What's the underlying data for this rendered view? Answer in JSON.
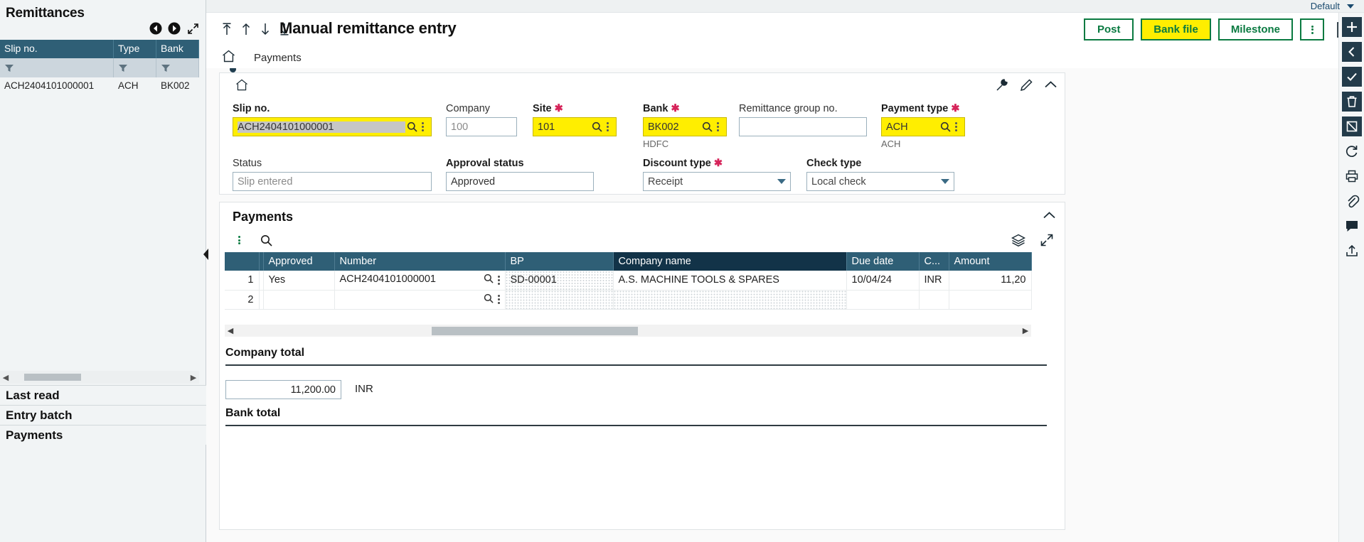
{
  "left_panel": {
    "title": "Remittances",
    "nav": {
      "prev": "prev-record",
      "next": "next-record",
      "expand": "expand"
    },
    "columns": [
      "Slip no.",
      "Type",
      "Bank"
    ],
    "rows": [
      {
        "slip_no": "ACH2404101000001",
        "type": "ACH",
        "bank": "BK002"
      }
    ],
    "sections": [
      "Last read",
      "Entry batch",
      "Payments"
    ]
  },
  "topbar": {
    "profile": "Default"
  },
  "header": {
    "title": "Manual remittance entry",
    "buttons": {
      "post": "Post",
      "bank_file": "Bank file",
      "milestone": "Milestone"
    },
    "colors": {
      "green": "#0a7a41",
      "yellow": "#ffee00",
      "header_blue": "#2f5f76",
      "active_col": "#123348"
    }
  },
  "breadcrumb": {
    "home": "home-icon",
    "text": "Payments"
  },
  "form": {
    "slip_no": {
      "label": "Slip no.",
      "value": "ACH2404101000001",
      "required": false,
      "highlight": true
    },
    "company": {
      "label": "Company",
      "value": "100",
      "required": false,
      "highlight": false
    },
    "site": {
      "label": "Site",
      "value": "101",
      "required": true,
      "highlight": true
    },
    "bank": {
      "label": "Bank",
      "value": "BK002",
      "required": true,
      "highlight": true,
      "note": "HDFC"
    },
    "remit_group": {
      "label": "Remittance group no.",
      "value": "",
      "required": false,
      "highlight": false
    },
    "payment_type": {
      "label": "Payment type",
      "value": "ACH",
      "required": true,
      "highlight": true,
      "note": "ACH"
    },
    "status": {
      "label": "Status",
      "value": "Slip entered",
      "placeholder_style": true
    },
    "approval_status": {
      "label": "Approval status",
      "value": "Approved"
    },
    "discount_type": {
      "label": "Discount type",
      "value": "Receipt",
      "required": true
    },
    "check_type": {
      "label": "Check type",
      "value": "Local check",
      "required": false
    }
  },
  "payments_section": {
    "title": "Payments",
    "columns": [
      "",
      "",
      "Approved",
      "Number",
      "BP",
      "Company name",
      "Due date",
      "C...",
      "Amount"
    ],
    "active_column": "Company name",
    "rows": [
      {
        "n": "1",
        "approved": "Yes",
        "number": "ACH2404101000001",
        "bp": "SD-00001",
        "company_name": "A.S. MACHINE TOOLS & SPARES",
        "due_date": "10/04/24",
        "currency": "INR",
        "amount": "11,20"
      },
      {
        "n": "2",
        "approved": "",
        "number": "",
        "bp": "",
        "company_name": "",
        "due_date": "",
        "currency": "",
        "amount": ""
      }
    ],
    "company_total": {
      "label": "Company total",
      "value": "11,200.00",
      "currency": "INR"
    },
    "bank_total": {
      "label": "Bank total"
    }
  },
  "right_rail": {
    "icons": [
      "plus-icon",
      "chevron-left-icon",
      "check-icon",
      "trash-icon",
      "cancel-icon",
      "refresh-icon",
      "print-icon",
      "attachment-icon",
      "comment-icon",
      "share-icon"
    ]
  }
}
